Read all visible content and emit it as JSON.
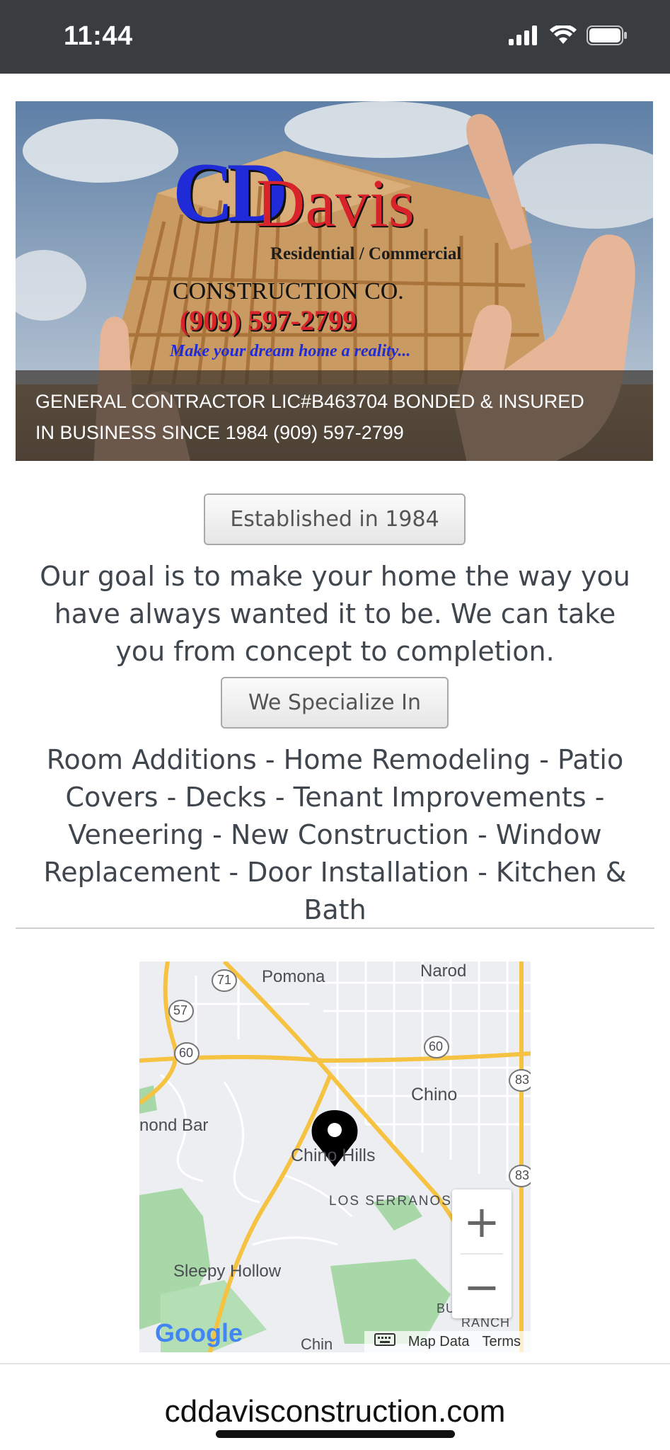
{
  "status_bar": {
    "time": "11:44"
  },
  "hero": {
    "logo_cd": "CD",
    "logo_davis": "Davis",
    "logo_subtitle": "Residential / Commercial",
    "logo_company": "CONSTRUCTION CO.",
    "logo_phone": "(909) 597-2799",
    "logo_tagline": "Make your dream home a reality...",
    "caption_line1": "GENERAL CONTRACTOR LIC#B463704 BONDED & INSURED",
    "caption_line2": "IN BUSINESS SINCE 1984 (909) 597-2799"
  },
  "established_label": "Established in 1984",
  "goal_text": "Our goal is to make your home the way you have always wanted it to be. We can take you from concept to completion.",
  "specialize_label": "We Specialize In",
  "services_text": "Room Additions - Home Remodeling - Patio Covers - Decks - Tenant Improvements - Veneering - New Construction - Window Replacement - Door Installation - Kitchen & Bath",
  "map": {
    "places": {
      "pomona": "Pomona",
      "narod": "Narod",
      "chino": "Chino",
      "diamond_bar": "nond Bar",
      "chino_hills": "Chino Hills",
      "los_serranos": "LOS SERRANOS",
      "sleepy_hollow": "Sleepy Hollow",
      "ranch": "RANCH",
      "butterfield": "BU      EL",
      "chino_bottom": "Chin",
      "route_71": "71",
      "route_57": "57",
      "route_60a": "60",
      "route_60b": "60",
      "route_83a": "83",
      "route_83b": "83"
    },
    "zoom_in": "+",
    "zoom_out": "−",
    "google_logo": "Google",
    "map_data": "Map Data",
    "terms": "Terms"
  },
  "url": "cddavisconstruction.com",
  "colors": {
    "status_bg": "#393d40",
    "accent_red": "#d8232a",
    "accent_blue": "#1f2bd6",
    "road_yellow": "#f5c242",
    "park_green": "#a8d8a8"
  }
}
